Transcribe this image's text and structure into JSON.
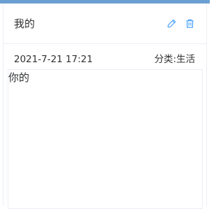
{
  "note": {
    "title": "我的",
    "date": "2021-7-21 17:21",
    "category_label": "分类:",
    "category_value": "生活",
    "content": "你的"
  },
  "icons": {
    "edit": "edit-icon",
    "delete": "delete-icon"
  },
  "colors": {
    "top_bar": "#6a9fd1",
    "icon_accent": "#409eff",
    "text": "#303133",
    "border": "#ebeef5"
  }
}
